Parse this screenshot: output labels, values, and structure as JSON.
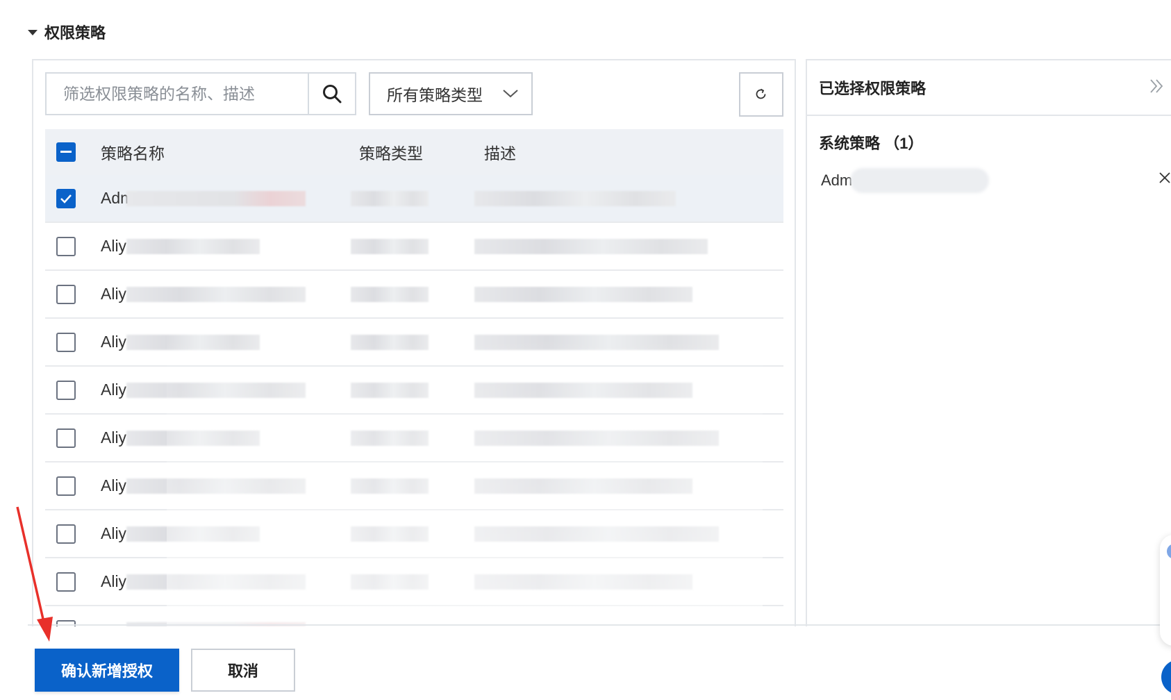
{
  "section": {
    "title": "权限策略"
  },
  "search": {
    "placeholder": "筛选权限策略的名称、描述"
  },
  "filter": {
    "selected": "所有策略类型"
  },
  "table": {
    "headers": {
      "name": "策略名称",
      "type": "策略类型",
      "desc": "描述"
    },
    "rows": [
      {
        "name": "Adm",
        "checked": true
      },
      {
        "name": "Aliy",
        "checked": false
      },
      {
        "name": "Aliy",
        "checked": false
      },
      {
        "name": "Aliy",
        "checked": false
      },
      {
        "name": "Aliy",
        "checked": false
      },
      {
        "name": "Aliy",
        "checked": false
      },
      {
        "name": "Aliy",
        "checked": false
      },
      {
        "name": "Aliy",
        "checked": false
      },
      {
        "name": "Aliy",
        "checked": false
      }
    ]
  },
  "selected_panel": {
    "title": "已选择权限策略",
    "group_title": "系统策略 （1）",
    "items": [
      {
        "name": "Adm"
      }
    ]
  },
  "footer": {
    "confirm_label": "确认新增授权",
    "cancel_label": "取消"
  },
  "colors": {
    "primary": "#0a62c9",
    "annotation_arrow": "#e8302a"
  }
}
